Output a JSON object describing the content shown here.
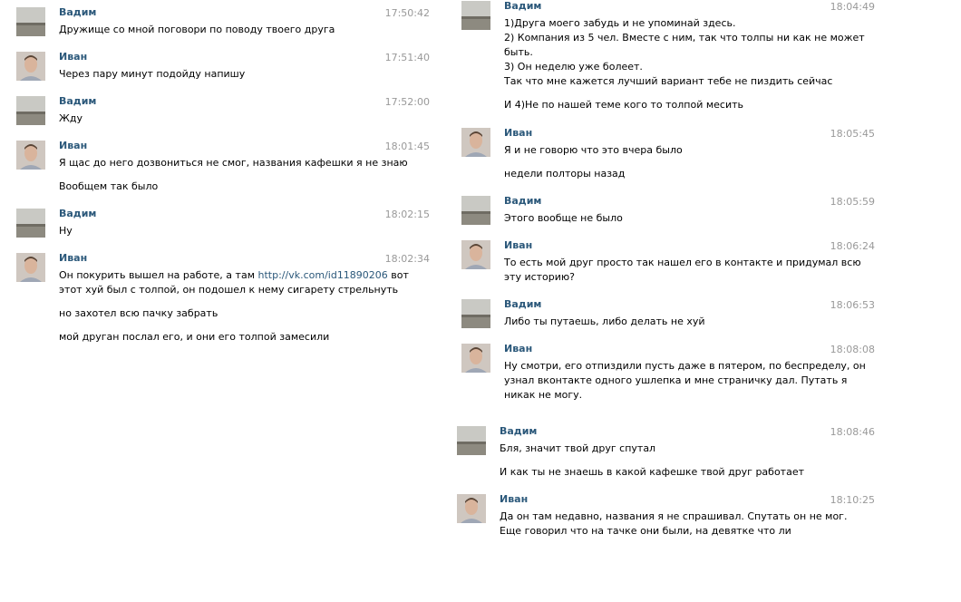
{
  "left_column": [
    {
      "author": "Вадим",
      "avatar": "landscape-avatar",
      "time": "17:50:42",
      "lines": [
        "Дружище со мной поговори по поводу твоего друга"
      ]
    },
    {
      "author": "Иван",
      "avatar": "person-avatar",
      "time": "17:51:40",
      "lines": [
        "Через пару минут подойду напишу"
      ]
    },
    {
      "author": "Вадим",
      "avatar": "landscape-avatar",
      "time": "17:52:00",
      "lines": [
        "Жду"
      ]
    },
    {
      "author": "Иван",
      "avatar": "person-avatar",
      "time": "18:01:45",
      "lines": [
        "Я щас до него дозвониться не смог, названия кафешки я не знаю",
        "Вообщем так было"
      ]
    },
    {
      "author": "Вадим",
      "avatar": "landscape-avatar",
      "time": "18:02:15",
      "lines": [
        "Ну"
      ]
    },
    {
      "author": "Иван",
      "avatar": "person-avatar",
      "time": "18:02:34",
      "lines": [
        "Он покурить вышел на работе, а там",
        "этот хуй был с толпой, он подошел к нему сигарету стрельнуть",
        "но захотел всю пачку забрать",
        "мой друган послал его, и они его толпой замесили"
      ],
      "link": "http://vk.com/id11890206",
      "link_suffix": " вот"
    }
  ],
  "right_column": [
    {
      "author": "Вадим",
      "avatar": "landscape-avatar",
      "time": "18:04:49",
      "lines": [
        "1)Друга моего забудь и не упоминай здесь.",
        "2) Компания из 5 чел. Вместе с ним, так что толпы ни как не может",
        "быть.",
        "3) Он неделю уже болеет.",
        "Так что мне кажется лучший вариант тебе не пиздить сейчас",
        "И 4)Не по нашей теме кого то толпой месить"
      ]
    },
    {
      "author": "Иван",
      "avatar": "person-avatar",
      "time": "18:05:45",
      "lines": [
        "Я и не говорю что это вчера было",
        "недели полторы назад"
      ]
    },
    {
      "author": "Вадим",
      "avatar": "landscape-avatar",
      "time": "18:05:59",
      "lines": [
        "Этого вообще не было"
      ]
    },
    {
      "author": "Иван",
      "avatar": "person-avatar",
      "time": "18:06:24",
      "lines": [
        "То есть мой друг просто так нашел его в контакте и придумал всю",
        "эту историю?"
      ]
    },
    {
      "author": "Вадим",
      "avatar": "landscape-avatar",
      "time": "18:06:53",
      "lines": [
        "Либо ты путаешь, либо делать не хуй"
      ]
    },
    {
      "author": "Иван",
      "avatar": "person-avatar",
      "time": "18:08:08",
      "lines": [
        "Ну смотри, его отпиздили пусть даже в пятером, по беспределу, он",
        "узнал вконтакте одного ушлепка и мне страничку дал. Путать я",
        "никак не могу."
      ]
    },
    {
      "author": "Вадим",
      "avatar": "landscape-avatar",
      "time": "18:08:46",
      "lines": [
        "Бля, значит твой друг спутал",
        "И как ты не знаешь в какой кафешке твой друг работает"
      ]
    },
    {
      "author": "Иван",
      "avatar": "person-avatar",
      "time": "18:10:25",
      "lines": [
        "Да он там недавно, названия я не спрашивал. Спутать он не мог.",
        "Еще говорил что на тачке они были, на девятке что ли"
      ]
    }
  ]
}
